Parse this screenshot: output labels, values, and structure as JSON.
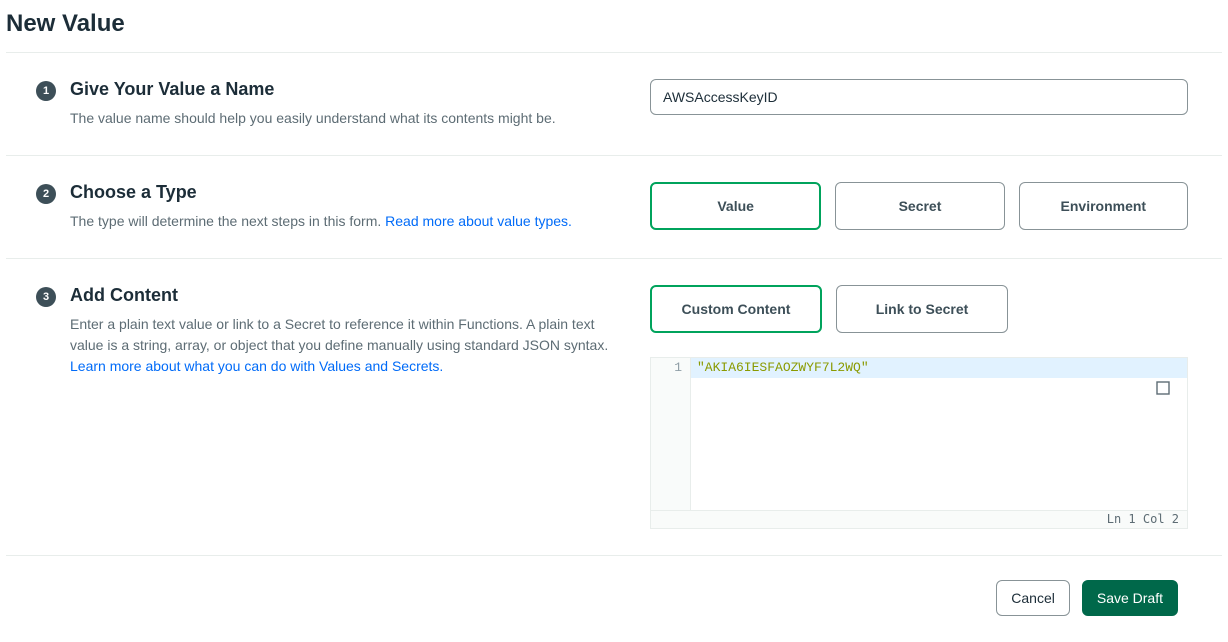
{
  "page": {
    "title": "New Value"
  },
  "step1": {
    "number": "1",
    "heading": "Give Your Value a Name",
    "desc": "The value name should help you easily understand what its contents might be.",
    "input_value": "AWSAccessKeyID"
  },
  "step2": {
    "number": "2",
    "heading": "Choose a Type",
    "desc_prefix": "The type will determine the next steps in this form. ",
    "link_text": "Read more about value types.",
    "options": {
      "value": "Value",
      "secret": "Secret",
      "environment": "Environment"
    }
  },
  "step3": {
    "number": "3",
    "heading": "Add Content",
    "desc_prefix": "Enter a plain text value or link to a Secret to reference it within Functions. A plain text value is a string, array, or object that you define manually using standard JSON syntax. ",
    "link_text": "Learn more about what you can do with Values and Secrets.",
    "options": {
      "custom": "Custom Content",
      "link_secret": "Link to Secret"
    },
    "editor": {
      "line_number": "1",
      "content": "\"AKIA6IESFAOZWYF7L2WQ\"",
      "status": "Ln 1 Col 2"
    }
  },
  "footer": {
    "cancel": "Cancel",
    "save": "Save Draft"
  }
}
